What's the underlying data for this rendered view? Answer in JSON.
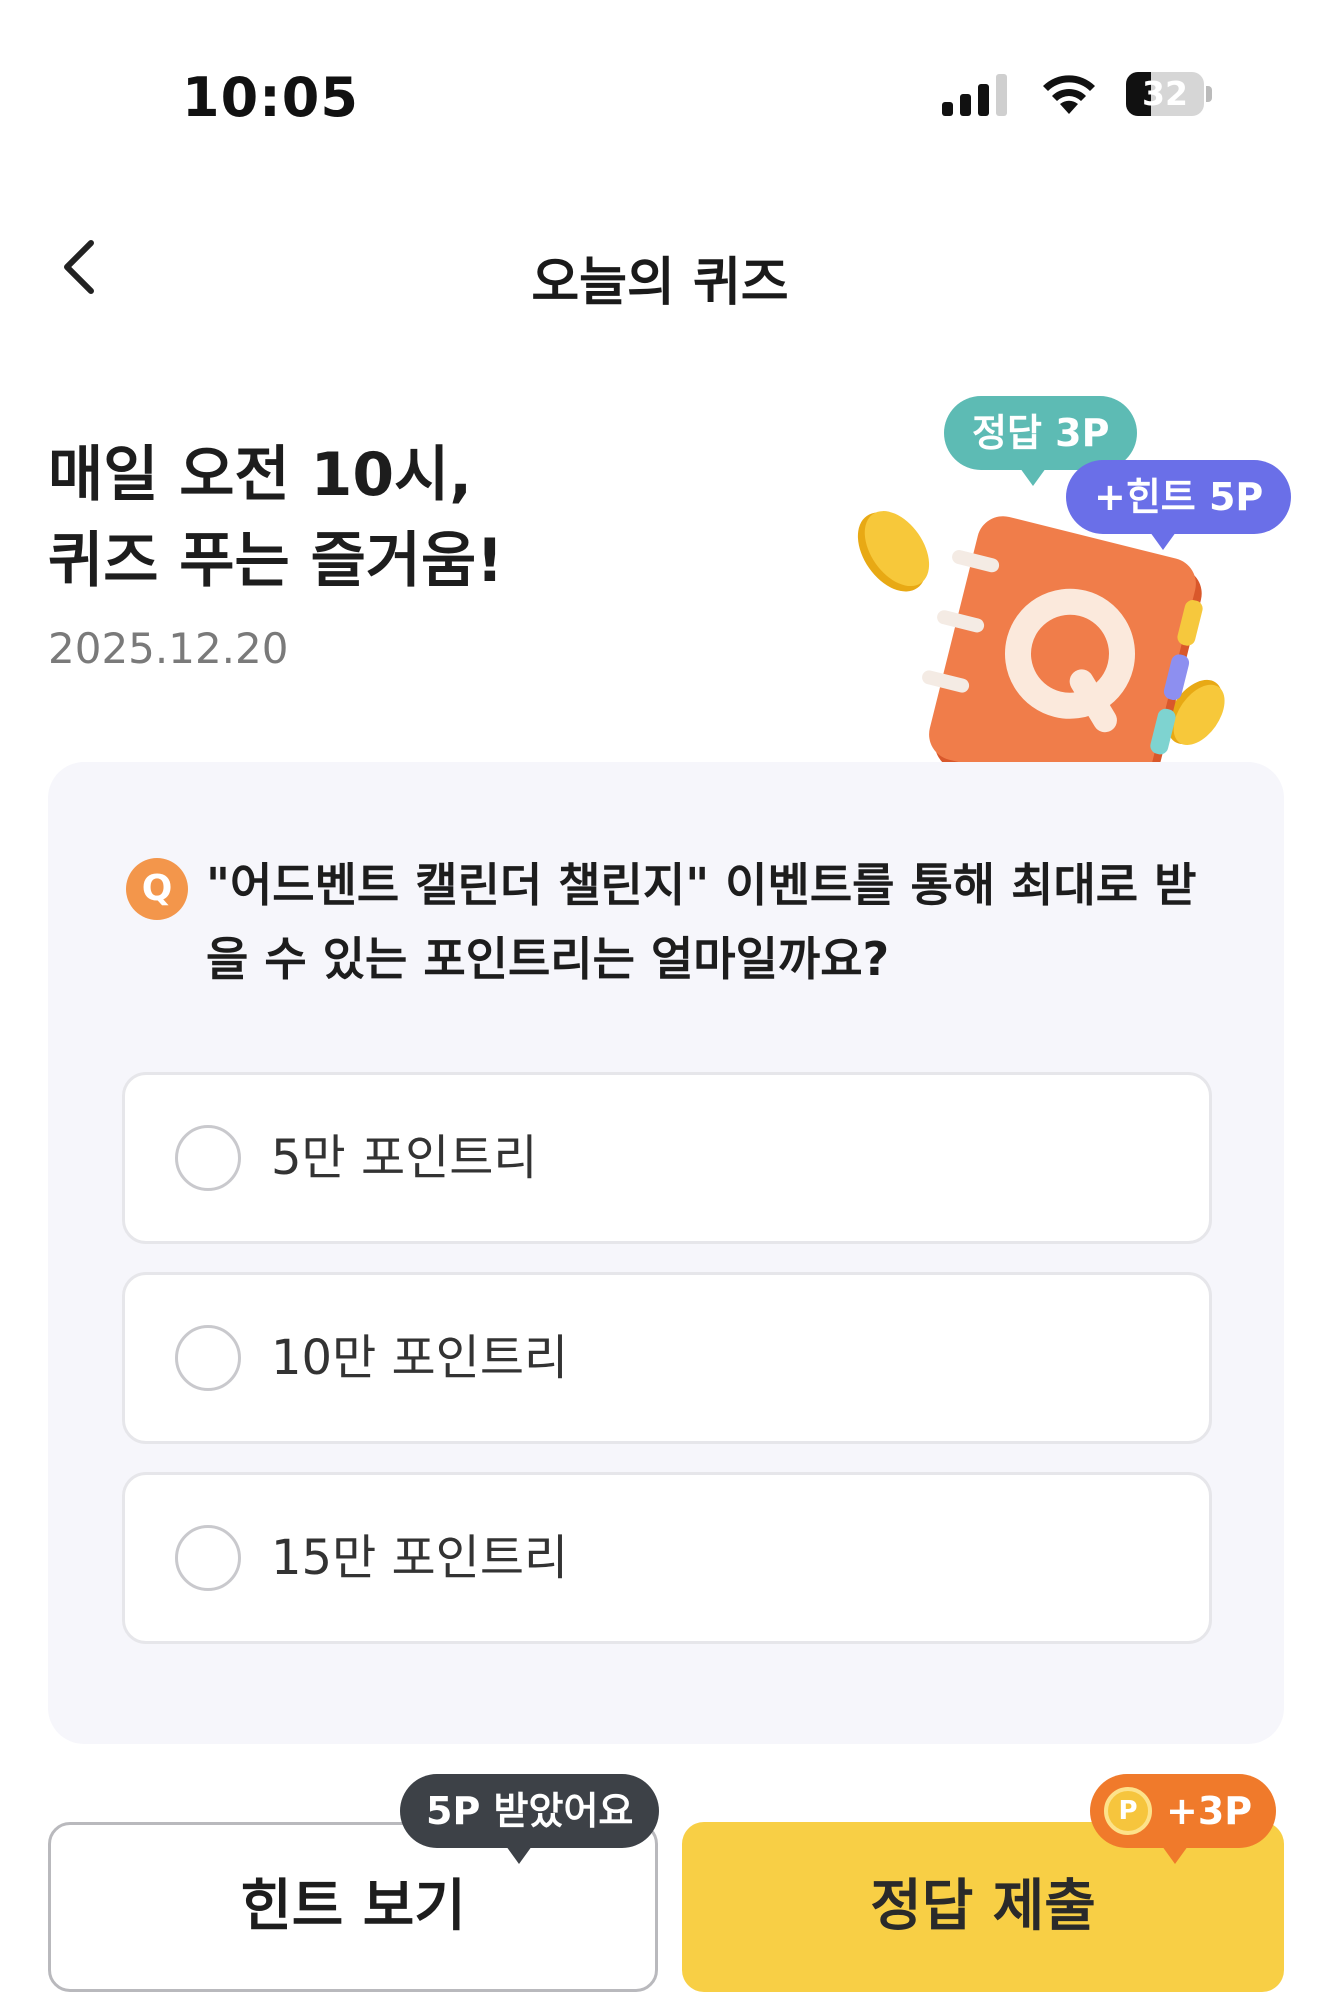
{
  "status_bar": {
    "time": "10:05",
    "battery": "32",
    "battery_level": 0.32
  },
  "header": {
    "title": "오늘의 퀴즈"
  },
  "hero": {
    "title_line1": "매일 오전 10시,",
    "title_line2": "퀴즈 푸는 즐거움!",
    "date": "2025.12.20",
    "bubble_answer": "정답 3P",
    "bubble_hint": "+힌트 5P",
    "illustration_letter": "Q"
  },
  "quiz": {
    "badge": "Q",
    "question": "\"어드벤트 캘린더 챌린지\" 이벤트를 통해 최대로 받을 수 있는 포인트리는 얼마일까요?",
    "options": [
      {
        "label": "5만 포인트리"
      },
      {
        "label": "10만 포인트리"
      },
      {
        "label": "15만 포인트리"
      }
    ]
  },
  "actions": {
    "hint_label": "힌트 보기",
    "hint_tooltip": "5P 받았어요",
    "submit_label": "정답 제출",
    "reward_coin": "P",
    "reward_text": "+3P"
  },
  "colors": {
    "accent_yellow": "#f8cf45",
    "accent_orange": "#f07a2b",
    "answer_bubble": "#5dbbb4",
    "hint_bubble": "#6a6fe8",
    "tooltip_dark": "#3d4147",
    "card_bg": "#f6f6fb"
  },
  "icons": {
    "back": "chevron-left-icon",
    "signal": "cellular-signal-icon",
    "wifi": "wifi-icon",
    "battery": "battery-icon",
    "coin": "coin-icon"
  }
}
